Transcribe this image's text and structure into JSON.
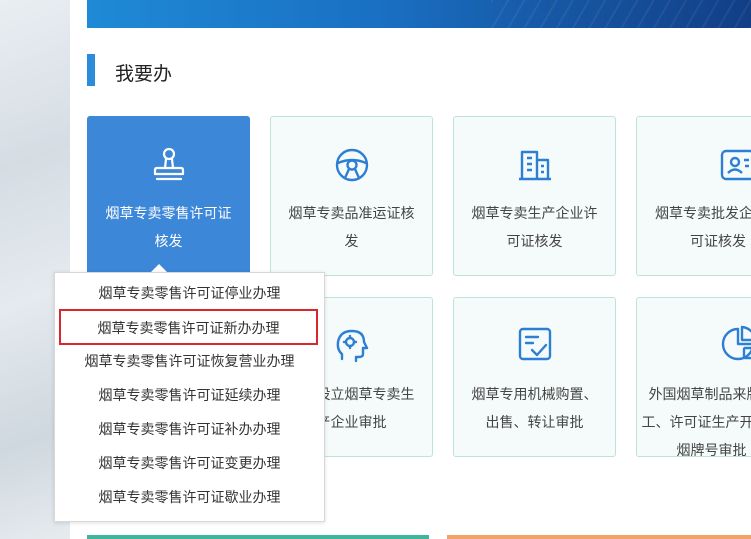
{
  "section": {
    "title": "我要办"
  },
  "cards": [
    {
      "label": "烟草专卖零售许可证核发",
      "icon": "stamp-icon"
    },
    {
      "label": "烟草专卖品准运证核发",
      "icon": "steering-wheel-icon"
    },
    {
      "label": "烟草专卖生产企业许可证核发",
      "icon": "building-icon"
    },
    {
      "label": "烟草专卖批发企业许可证核发",
      "icon": "id-card-icon"
    },
    {
      "label": "投资设立烟草专卖生产企业审批",
      "icon": "head-settings-icon"
    },
    {
      "label": "烟草专用机械购置、出售、转让审批",
      "icon": "checklist-icon"
    },
    {
      "label": "外国烟草制品来牌加工、许可证生产开发卷烟牌号审批",
      "icon": "pie-chart-icon"
    }
  ],
  "dropdown": {
    "items": [
      "烟草专卖零售许可证停业办理",
      "烟草专卖零售许可证新办办理",
      "烟草专卖零售许可证恢复营业办理",
      "烟草专卖零售许可证延续办理",
      "烟草专卖零售许可证补办办理",
      "烟草专卖零售许可证变更办理",
      "烟草专卖零售许可证歇业办理"
    ]
  },
  "colors": {
    "accent": "#3d87d8",
    "highlight": "#d9272b",
    "icon": "#2d7fd3",
    "card_border": "#bde3da"
  }
}
